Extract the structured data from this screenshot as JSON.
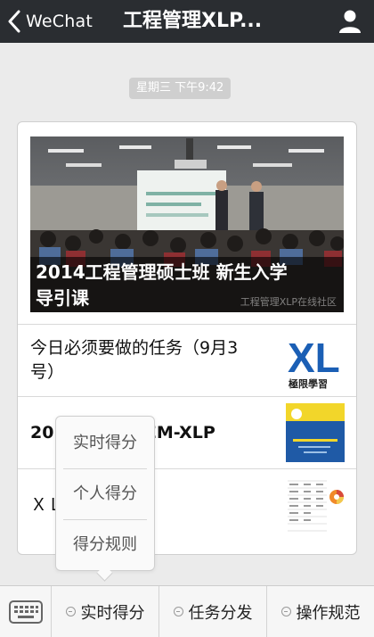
{
  "header": {
    "back_label": "WeChat",
    "title": "工程管理XLP..."
  },
  "chat": {
    "timestamp": "星期三 下午9:42"
  },
  "article": {
    "hero_title_line1": "2014工程管理硕士班 新生入学",
    "hero_title_line2": "导引课",
    "hero_watermark": "工程管理XLP在线社区",
    "items": [
      {
        "line1": "今日必须要做的任务（9月3",
        "line2": "号）"
      },
      {
        "line1": "2014工程管理EM-XLP",
        "line2": ""
      },
      {
        "line1": "ＸＬＰ计分规则",
        "line2": ""
      }
    ],
    "thumb_logo_text": "XL",
    "thumb_logo_caption": "極限學習"
  },
  "popup_menu": {
    "items": [
      "实时得分",
      "个人得分",
      "得分规则"
    ]
  },
  "bottom_menu": {
    "items": [
      "实时得分",
      "任务分发",
      "操作规范"
    ]
  },
  "colors": {
    "topbar": "#2a2d31",
    "background": "#ebebeb",
    "accent_blue": "#1b5fb5"
  }
}
